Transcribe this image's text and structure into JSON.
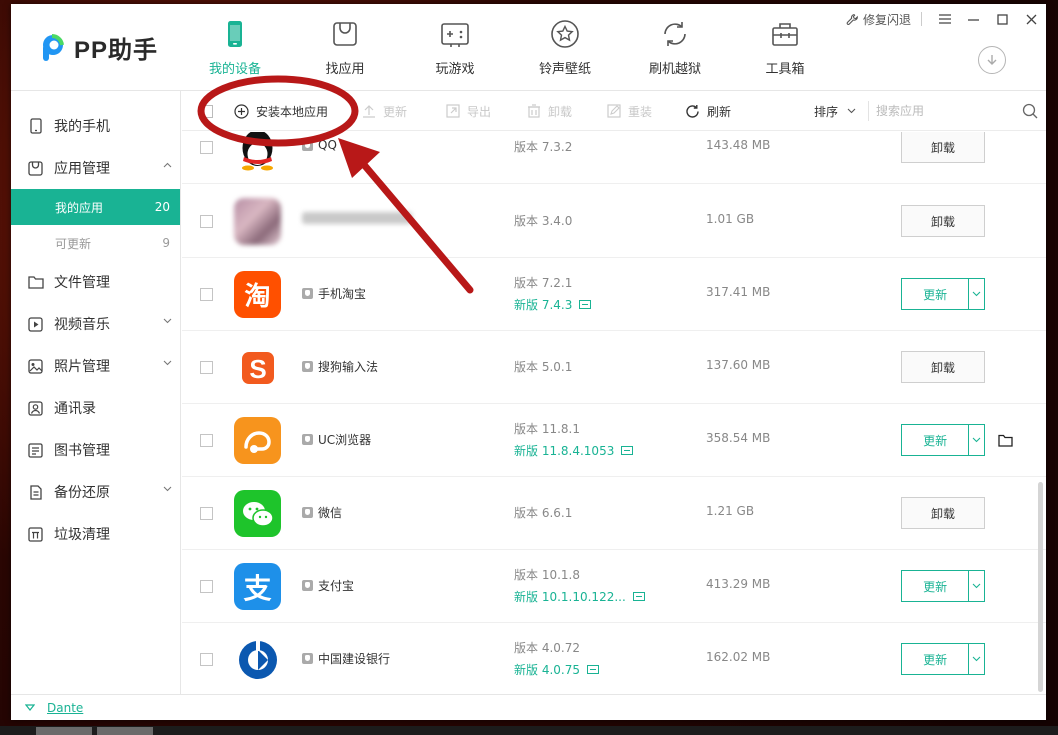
{
  "app": {
    "name": "PP助手"
  },
  "window": {
    "repair_label": "修复闪退",
    "menu_icon": "menu-icon",
    "minimize_icon": "minimize-icon",
    "maximize_icon": "maximize-icon",
    "close_icon": "close-icon"
  },
  "nav": [
    {
      "label": "我的设备",
      "icon": "phone-icon",
      "active": true
    },
    {
      "label": "找应用",
      "icon": "shopping-bag-icon",
      "active": false
    },
    {
      "label": "玩游戏",
      "icon": "gamepad-icon",
      "active": false
    },
    {
      "label": "铃声壁纸",
      "icon": "star-icon",
      "active": false
    },
    {
      "label": "刷机越狱",
      "icon": "refresh-icon",
      "active": false
    },
    {
      "label": "工具箱",
      "icon": "toolbox-icon",
      "active": false
    }
  ],
  "sidebar": {
    "items": [
      {
        "label": "我的手机",
        "icon": "phone-icon"
      },
      {
        "label": "应用管理",
        "icon": "app-bag-icon",
        "expanded": true
      },
      {
        "label": "文件管理",
        "icon": "folder-icon"
      },
      {
        "label": "视频音乐",
        "icon": "play-icon"
      },
      {
        "label": "照片管理",
        "icon": "photo-icon"
      },
      {
        "label": "通讯录",
        "icon": "contacts-icon"
      },
      {
        "label": "图书管理",
        "icon": "book-icon"
      },
      {
        "label": "备份还原",
        "icon": "backup-icon"
      },
      {
        "label": "垃圾清理",
        "icon": "trash-icon"
      }
    ],
    "sub": [
      {
        "label": "我的应用",
        "count": "20",
        "active": true
      },
      {
        "label": "可更新",
        "count": "9",
        "active": false
      }
    ]
  },
  "toolbar": {
    "install_label": "安装本地应用",
    "update_label": "更新",
    "export_label": "导出",
    "uninstall_label": "卸载",
    "reinstall_label": "重装",
    "refresh_label": "刷新",
    "sort_label": "排序",
    "search_placeholder": "搜索应用"
  },
  "apps": [
    {
      "name": "QQ",
      "version": "版本 7.3.2",
      "size": "143.48 MB",
      "action": "卸载",
      "icon": "qq-penguin-icon"
    },
    {
      "name": "",
      "version": "版本 3.4.0",
      "size": "1.01 GB",
      "action": "卸载",
      "icon": "blurred-app-icon"
    },
    {
      "name": "手机淘宝",
      "version": "版本 7.2.1",
      "new_version": "新版 7.4.3",
      "size": "317.41 MB",
      "action": "更新",
      "icon": "taobao-icon",
      "color": "#ff5000"
    },
    {
      "name": "搜狗输入法",
      "version": "版本 5.0.1",
      "size": "137.60 MB",
      "action": "卸载",
      "icon": "sogou-icon",
      "color": "#f25a1e"
    },
    {
      "name": "UC浏览器",
      "version": "版本 11.8.1",
      "new_version": "新版 11.8.4.1053",
      "size": "358.54 MB",
      "action": "更新",
      "icon": "uc-browser-icon",
      "color": "#f7941d"
    },
    {
      "name": "微信",
      "version": "版本 6.6.1",
      "size": "1.21 GB",
      "action": "卸载",
      "icon": "wechat-icon",
      "color": "#1ec42b"
    },
    {
      "name": "支付宝",
      "version": "版本 10.1.8",
      "new_version": "新版 10.1.10.122...",
      "size": "413.29 MB",
      "action": "更新",
      "icon": "alipay-icon",
      "color": "#1e90e9"
    },
    {
      "name": "中国建设银行",
      "version": "版本 4.0.72",
      "new_version": "新版 4.0.75",
      "size": "162.02 MB",
      "action": "更新",
      "icon": "ccb-icon",
      "color": "#0b58b0"
    }
  ],
  "footer": {
    "user": "Dante"
  },
  "colors": {
    "accent": "#19b394",
    "annotation": "#b81818"
  }
}
